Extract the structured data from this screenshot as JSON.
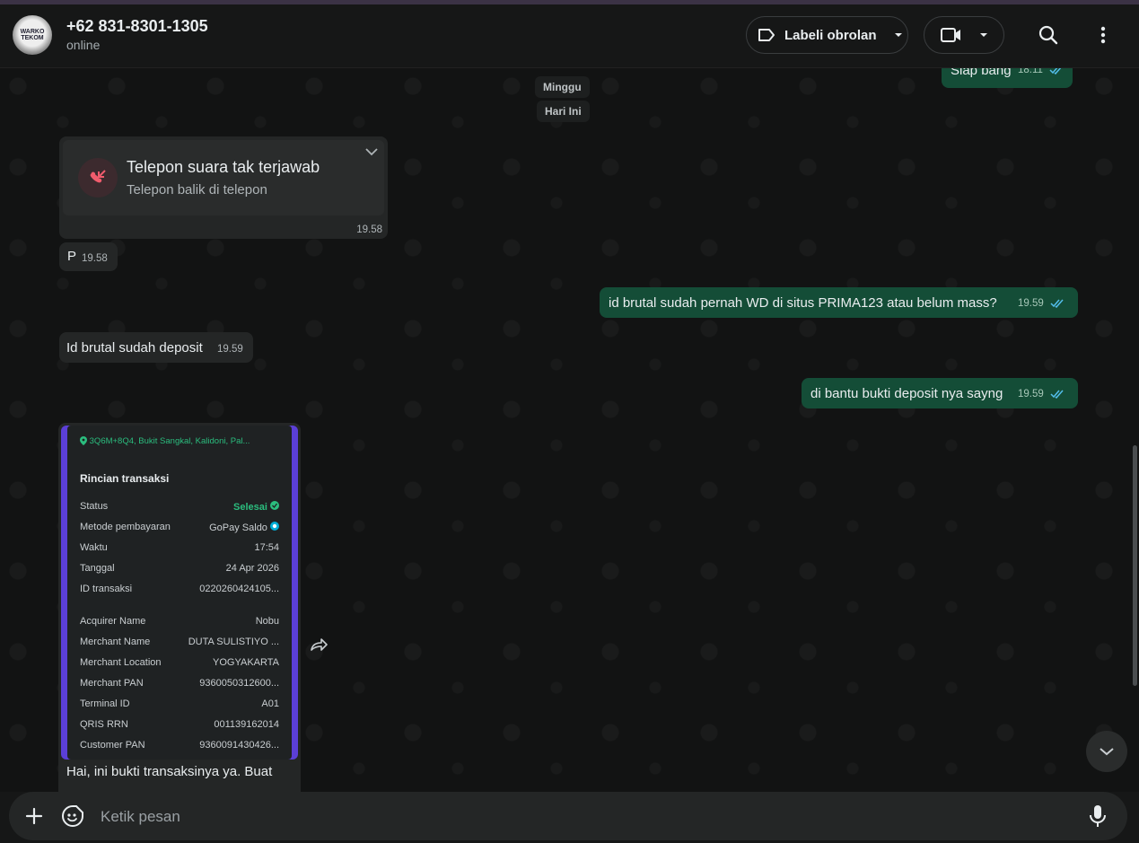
{
  "header": {
    "avatar_text": "WARKO TEKOM",
    "contact_name": "+62 831-8301-1305",
    "status": "online",
    "label_button": "Labeli obrolan"
  },
  "chat": {
    "days": [
      "Minggu",
      "Hari Ini"
    ],
    "messages": [
      {
        "dir": "out",
        "text": "Siap bang",
        "time": "18.11"
      },
      {
        "dir": "in",
        "type": "missed-call",
        "title": "Telepon suara tak terjawab",
        "subtitle": "Telepon balik di telepon",
        "time": "19.58"
      },
      {
        "dir": "in",
        "text": "P",
        "time": "19.58"
      },
      {
        "dir": "out",
        "text": "id brutal sudah pernah WD di situs PRIMA123 atau belum mass?",
        "time": "19.59"
      },
      {
        "dir": "in",
        "text": "Id brutal sudah deposit",
        "time": "19.59"
      },
      {
        "dir": "out",
        "text": "di bantu bukti deposit nya sayng",
        "time": "19.59"
      },
      {
        "dir": "in",
        "type": "image",
        "caption": "Hai, ini bukti transaksinya ya. Buat"
      }
    ]
  },
  "receipt": {
    "location": "3Q6M+8Q4, Bukit Sangkal, Kalidoni, Pal...",
    "title": "Rincian transaksi",
    "rows": [
      {
        "label": "Status",
        "value": "Selesai"
      },
      {
        "label": "Metode pembayaran",
        "value": "GoPay Saldo"
      },
      {
        "label": "Waktu",
        "value": "17:54"
      },
      {
        "label": "Tanggal",
        "value": "24 Apr 2026"
      },
      {
        "label": "ID transaksi",
        "value": "0220260424105..."
      },
      {
        "label": "Acquirer Name",
        "value": "Nobu"
      },
      {
        "label": "Merchant Name",
        "value": "DUTA SULISTIYO ..."
      },
      {
        "label": "Merchant Location",
        "value": "YOGYAKARTA"
      },
      {
        "label": "Merchant PAN",
        "value": "9360050312600..."
      },
      {
        "label": "Terminal ID",
        "value": "A01"
      },
      {
        "label": "QRIS RRN",
        "value": "001139162014"
      },
      {
        "label": "Customer PAN",
        "value": "9360091430426..."
      }
    ]
  },
  "composer": {
    "placeholder": "Ketik pesan"
  },
  "colors": {
    "accent": "#25d366",
    "outgoing": "#144d37",
    "incoming": "#242626",
    "read_ticks": "#53bdeb",
    "missed_call": "#f15c6d"
  }
}
